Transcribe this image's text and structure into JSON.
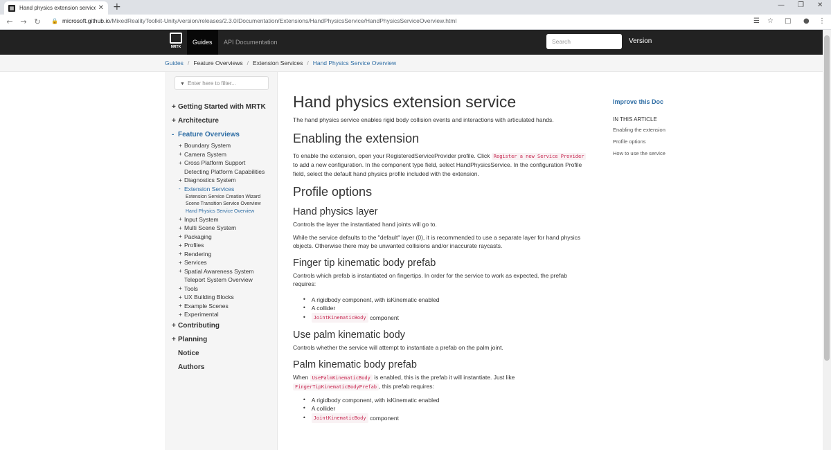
{
  "browser": {
    "tab_title": "Hand physics extension service |",
    "url_host": "microsoft.github.io",
    "url_path": "/MixedRealityToolkit-Unity/version/releases/2.3.0/Documentation/Extensions/HandPhysicsService/HandPhysicsServiceOverview.html"
  },
  "navbar": {
    "logo_text": "MRTK",
    "links": [
      "Guides",
      "API Documentation"
    ],
    "search_placeholder": "Search",
    "version_label": "Version"
  },
  "breadcrumb": [
    "Guides",
    "Feature Overviews",
    "Extension Services",
    "Hand Physics Service Overview"
  ],
  "sidebar": {
    "filter_placeholder": "Enter here to filter...",
    "top_items": [
      {
        "exp": "+",
        "label": "Getting Started with MRTK"
      },
      {
        "exp": "+",
        "label": "Architecture"
      },
      {
        "exp": "-",
        "label": "Feature Overviews"
      }
    ],
    "feature_items": [
      {
        "exp": "+",
        "label": "Boundary System"
      },
      {
        "exp": "+",
        "label": "Camera System"
      },
      {
        "exp": "+",
        "label": "Cross Platform Support"
      },
      {
        "exp": "",
        "label": "Detecting Platform Capabilities"
      },
      {
        "exp": "+",
        "label": "Diagnostics System"
      },
      {
        "exp": "-",
        "label": "Extension Services"
      }
    ],
    "extension_items": [
      "Extension Service Creation Wizard",
      "Scene Transition Service Overview",
      "Hand Physics Service Overview"
    ],
    "more_feature_items": [
      {
        "exp": "+",
        "label": "Input System"
      },
      {
        "exp": "+",
        "label": "Multi Scene System"
      },
      {
        "exp": "+",
        "label": "Packaging"
      },
      {
        "exp": "+",
        "label": "Profiles"
      },
      {
        "exp": "+",
        "label": "Rendering"
      },
      {
        "exp": "+",
        "label": "Services"
      },
      {
        "exp": "+",
        "label": "Spatial Awareness System"
      },
      {
        "exp": "",
        "label": "Teleport System Overview"
      },
      {
        "exp": "+",
        "label": "Tools"
      },
      {
        "exp": "+",
        "label": "UX Building Blocks"
      },
      {
        "exp": "+",
        "label": "Example Scenes"
      },
      {
        "exp": "+",
        "label": "Experimental"
      }
    ],
    "bottom_items": [
      {
        "exp": "+",
        "label": "Contributing"
      },
      {
        "exp": "+",
        "label": "Planning"
      },
      {
        "exp": "",
        "label": "Notice"
      },
      {
        "exp": "",
        "label": "Authors"
      }
    ]
  },
  "article": {
    "title": "Hand physics extension service",
    "intro": "The hand physics service enables rigid body collision events and interactions with articulated hands.",
    "h_enabling": "Enabling the extension",
    "enabling_p1": "To enable the extension, open your RegisteredServiceProvider profile. Click ",
    "enabling_code": "Register a new Service Provider",
    "enabling_p2": " to add a new configuration. In the component type field, select HandPhysicsService. In the configuration Profile field, select the default hand physics profile included with the extension.",
    "h_profile": "Profile options",
    "h_layer": "Hand physics layer",
    "layer_p1": "Controls the layer the instantiated hand joints will go to.",
    "layer_p2": "While the service defaults to the \"default\" layer (0), it is recommended to use a separate layer for hand physics objects. Otherwise there may be unwanted collisions and/or inaccurate raycasts.",
    "h_finger": "Finger tip kinematic body prefab",
    "finger_p": "Controls which prefab is instantiated on fingertips. In order for the service to work as expected, the prefab requires:",
    "finger_list_1": "A rigidbody component, with isKinematic enabled",
    "finger_list_2": "A collider",
    "finger_list_3_code": "JointKinematicBody",
    "finger_list_3_text": " component",
    "h_usepalm": "Use palm kinematic body",
    "usepalm_p": "Controls whether the service will attempt to instantiate a prefab on the palm joint.",
    "h_palmprefab": "Palm kinematic body prefab",
    "palm_p_a": "When ",
    "palm_code_1": "UsePalmKinematicBody",
    "palm_p_b": " is enabled, this is the prefab it will instantiate. Just like ",
    "palm_code_2": "FingerTipKinematicBodyPrefab",
    "palm_p_c": ", this prefab requires:",
    "palm_list_1": "A rigidbody component, with isKinematic enabled",
    "palm_list_2": "A collider",
    "palm_list_3_code": "JointKinematicBody",
    "palm_list_3_text": " component"
  },
  "affix": {
    "improve": "Improve this Doc",
    "heading": "IN THIS ARTICLE",
    "items": [
      "Enabling the extension",
      "Profile options",
      "How to use the service"
    ]
  }
}
